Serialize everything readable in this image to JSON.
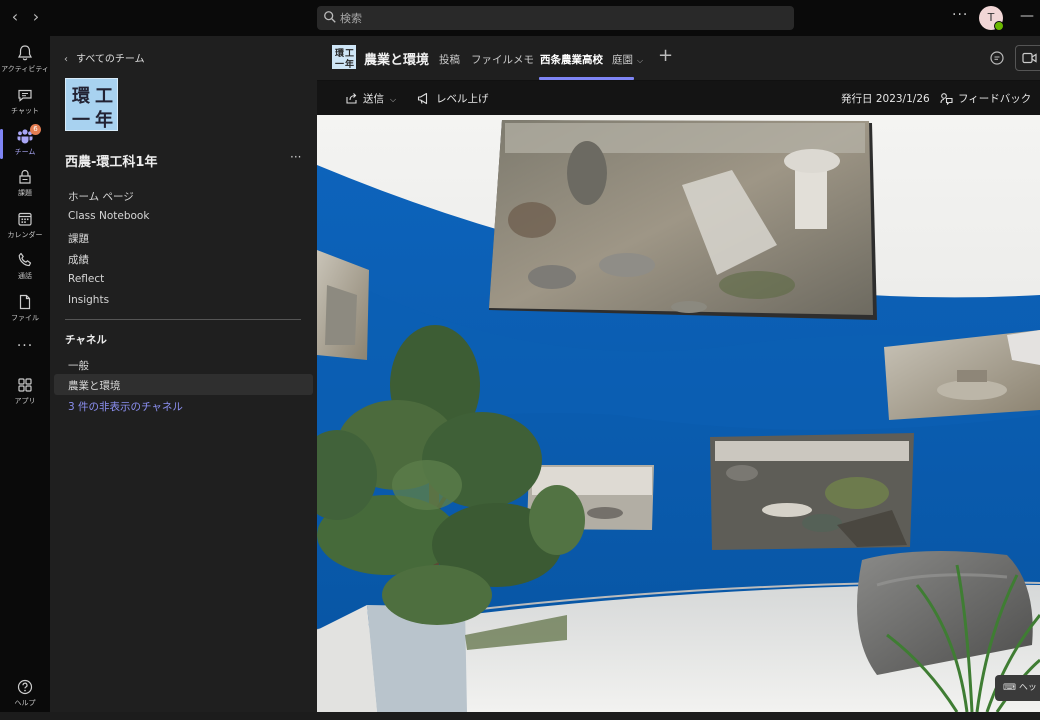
{
  "topbar": {
    "search_placeholder": "検索",
    "more": "···",
    "avatar_initial": "T",
    "minimize": "—"
  },
  "rail": [
    {
      "label": "アクティビティ",
      "icon": "bell-icon"
    },
    {
      "label": "チャット",
      "icon": "chat-icon"
    },
    {
      "label": "チーム",
      "icon": "teams-icon",
      "badge": "6",
      "active": true
    },
    {
      "label": "課題",
      "icon": "assignments-icon"
    },
    {
      "label": "カレンダー",
      "icon": "calendar-icon"
    },
    {
      "label": "通話",
      "icon": "phone-icon"
    },
    {
      "label": "ファイル",
      "icon": "file-icon"
    },
    {
      "label": "アプリ",
      "icon": "apps-icon"
    },
    {
      "label": "ヘルプ",
      "icon": "help-icon"
    }
  ],
  "panel": {
    "back_label": "すべてのチーム",
    "team_logo_text": [
      "環",
      "工",
      "一",
      "年"
    ],
    "team_name": "西農-環工科1年",
    "nav": [
      "ホーム ページ",
      "Class Notebook",
      "課題",
      "成績",
      "Reflect",
      "Insights"
    ],
    "channels_heading": "チャネル",
    "channels": [
      "一般",
      "農業と環境"
    ],
    "hidden_channels": "3 件の非表示のチャネル"
  },
  "channel": {
    "title": "農業と環境",
    "tabs": [
      "投稿",
      "ファイル",
      "メモ",
      "西条農業高校",
      "庭園"
    ],
    "active_tab": "西条農業高校"
  },
  "toolbar": {
    "send_label": "送信",
    "levelup_label": "レベル上げ",
    "issued_label": "発行日 2023/1/26",
    "feedback_label": "フィードバック"
  },
  "view": {
    "hint_label": "ヘッ"
  },
  "colors": {
    "accent": "#7f85f5",
    "wall_blue": "#0a5cb0",
    "badge": "#e37d52"
  }
}
